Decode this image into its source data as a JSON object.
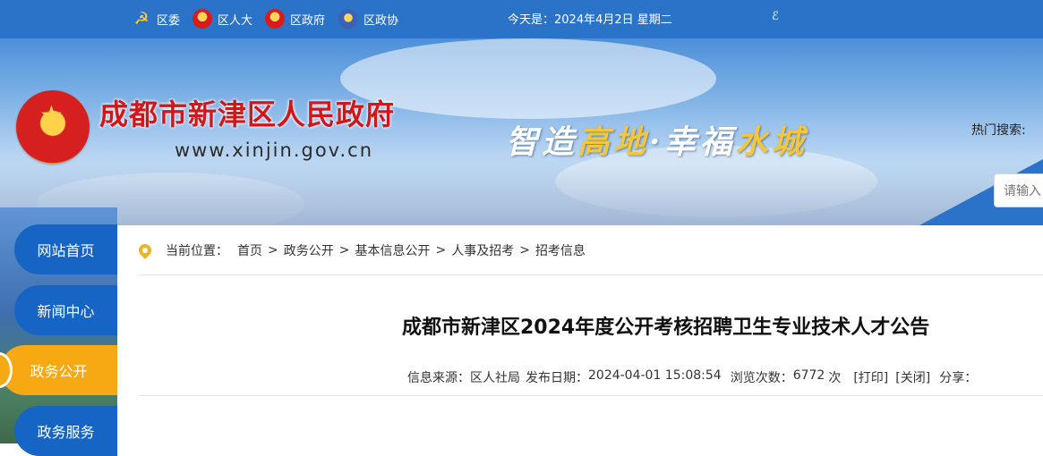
{
  "topbar": {
    "links": [
      "区委",
      "区人大",
      "区政府",
      "区政协"
    ],
    "date": "今天是：2024年4月2日 星期二",
    "util": "ℰ"
  },
  "banner": {
    "title": "成都市新津区人民政府",
    "url": "www.xinjin.gov.cn",
    "slogan": {
      "part1": "智造",
      "part2": "高地",
      "part3": "·幸福",
      "part4": "水城"
    },
    "hot_search_label": "热门搜索:",
    "search_placeholder": "请输入"
  },
  "nav": {
    "items": [
      {
        "label": "网站首页",
        "active": false
      },
      {
        "label": "新闻中心",
        "active": false
      },
      {
        "label": "政务公开",
        "active": true
      },
      {
        "label": "政务服务",
        "active": false
      }
    ]
  },
  "breadcrumb": {
    "prefix": "当前位置：",
    "items": [
      "首页",
      "政务公开",
      "基本信息公开",
      "人事及招考",
      "招考信息"
    ],
    "separator": ">"
  },
  "article": {
    "title": "成都市新津区2024年度公开考核招聘卫生专业技术人才公告",
    "source_label": "信息来源：",
    "source": "区人社局",
    "date_label": "发布日期：",
    "date": "2024-04-01 15:08:54",
    "views_label": "浏览次数：",
    "views": "6772",
    "views_unit": "次",
    "print": "[打印]",
    "close": "[关闭]",
    "share": "分享："
  },
  "colors": {
    "topbar": "#2a73c9",
    "nav": "#1665c4",
    "nav_active": "#f6a912",
    "title_red": "#d2171b"
  }
}
